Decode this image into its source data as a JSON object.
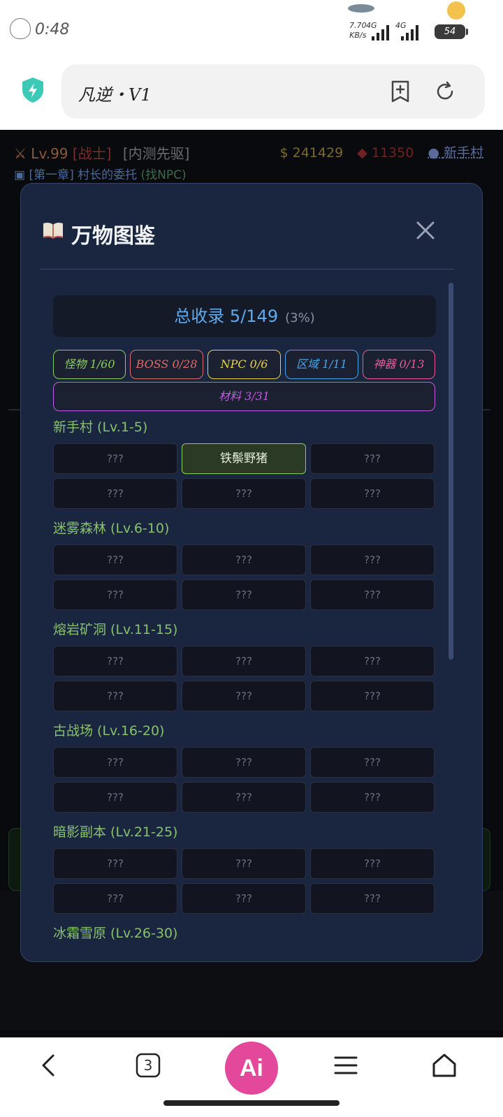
{
  "status_bar": {
    "time": "0:48",
    "net_speed": "7.70",
    "net_unit": "KB/s",
    "sim1": "4G",
    "sim2": "4G",
    "battery": "54"
  },
  "browser": {
    "title": "凡逆・V1",
    "icons": [
      "shield-bolt-icon",
      "add-bookmark-icon",
      "refresh-icon"
    ]
  },
  "hud": {
    "level": "Lv.99",
    "class": "[战士]",
    "tag": "[内测先驱]",
    "gold": "241429",
    "gems": "11350",
    "location": "新手村",
    "quest_chapter": "[第一章] 村长的委托",
    "quest_hint": "(找NPC)"
  },
  "modal": {
    "title": "万物图鉴",
    "total_label": "总收录 5/149",
    "total_percent": "(3%)",
    "filters": [
      {
        "label": "怪物 1/60",
        "color": "#8bcf5c"
      },
      {
        "label": "BOSS 0/28",
        "color": "#e06a6a"
      },
      {
        "label": "NPC 0/6",
        "color": "#e8d24a"
      },
      {
        "label": "区域 1/11",
        "color": "#4aa3e8"
      },
      {
        "label": "神器 0/13",
        "color": "#e85c9c"
      },
      {
        "label": "材料 3/31",
        "color": "#c25ce0"
      }
    ],
    "regions": [
      {
        "name": "新手村 (Lv.1-5)",
        "cells": [
          "???",
          "铁鬃野猪",
          "???",
          "???",
          "???",
          "???"
        ],
        "found_index": 1
      },
      {
        "name": "迷雾森林 (Lv.6-10)",
        "cells": [
          "???",
          "???",
          "???",
          "???",
          "???",
          "???"
        ]
      },
      {
        "name": "熔岩矿洞 (Lv.11-15)",
        "cells": [
          "???",
          "???",
          "???",
          "???",
          "???",
          "???"
        ]
      },
      {
        "name": "古战场 (Lv.16-20)",
        "cells": [
          "???",
          "???",
          "???",
          "???",
          "???",
          "???"
        ]
      },
      {
        "name": "暗影副本 (Lv.21-25)",
        "cells": [
          "???",
          "???",
          "???",
          "???",
          "???",
          "???"
        ]
      },
      {
        "name": "冰霜雪原 (Lv.26-30)",
        "cells": []
      }
    ]
  },
  "navbar": {
    "tab_count": "3",
    "ai_label": "Ai",
    "icons": [
      "back-icon",
      "tabs-icon",
      "ai-assistant-icon",
      "menu-icon",
      "home-icon"
    ]
  }
}
